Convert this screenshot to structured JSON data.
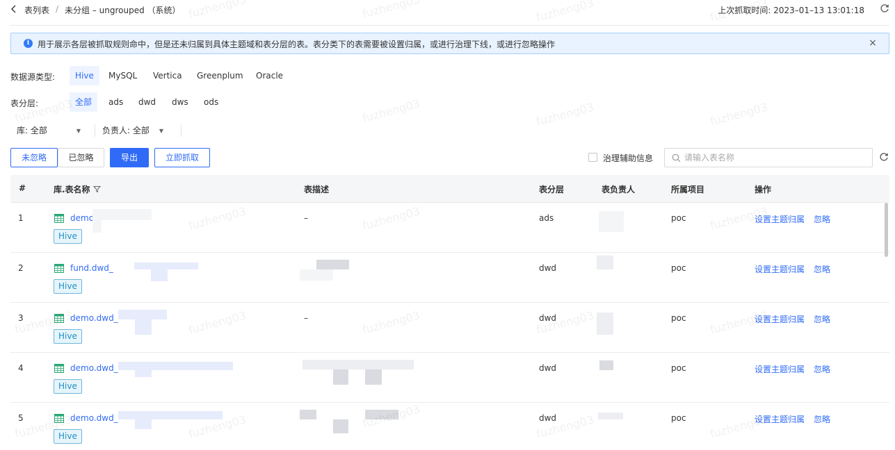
{
  "header": {
    "breadcrumb_parent": "表列表",
    "breadcrumb_sep": "/",
    "breadcrumb_current": "未分组 – ungrouped （系统）",
    "last_fetch": "上次抓取时间: 2023–01–13 13:01:18"
  },
  "alert": {
    "icon_glyph": "i",
    "text": "用于展示各层被抓取规则命中，但是还未归属到具体主题域和表分层的表。表分类下的表需要被设置归属，或进行治理下线，或进行忽略操作",
    "close_glyph": "×"
  },
  "datasource": {
    "label": "数据源类型:",
    "options": [
      "Hive",
      "MySQL",
      "Vertica",
      "Greenplum",
      "Oracle"
    ],
    "selected": "Hive"
  },
  "layer": {
    "label": "表分层:",
    "options": [
      "全部",
      "ads",
      "dwd",
      "dws",
      "ods"
    ],
    "selected": "全部"
  },
  "selects": {
    "db": "库: 全部",
    "owner": "负责人: 全部"
  },
  "actions": {
    "not_ignored": "未忽略",
    "ignored": "已忽略",
    "export": "导出",
    "fetch_now": "立即抓取",
    "governance_info": "治理辅助信息",
    "search_placeholder": "请输入表名称"
  },
  "table": {
    "columns": [
      "#",
      "库.表名称",
      "表描述",
      "表分层",
      "表负责人",
      "所属项目",
      "操作"
    ],
    "rows": [
      {
        "index": "1",
        "name": "demo",
        "tag": "Hive",
        "desc": "–",
        "layer": "ads",
        "project": "poc",
        "action_set": "设置主题归属",
        "action_ignore": "忽略"
      },
      {
        "index": "2",
        "name": "fund.dwd_",
        "tag": "Hive",
        "desc": "",
        "layer": "dwd",
        "project": "poc",
        "action_set": "设置主题归属",
        "action_ignore": "忽略"
      },
      {
        "index": "3",
        "name": "demo.dwd_",
        "tag": "Hive",
        "desc": "–",
        "layer": "dwd",
        "project": "poc",
        "action_set": "设置主题归属",
        "action_ignore": "忽略"
      },
      {
        "index": "4",
        "name": "demo.dwd_",
        "tag": "Hive",
        "desc": "",
        "layer": "dwd",
        "project": "poc",
        "action_set": "设置主题归属",
        "action_ignore": "忽略"
      },
      {
        "index": "5",
        "name": "demo.dwd_",
        "tag": "Hive",
        "desc": "",
        "layer": "dwd",
        "project": "poc",
        "action_set": "设置主题归属",
        "action_ignore": "忽略"
      }
    ]
  },
  "watermark": "fuzheng03",
  "colors": {
    "primary": "#2f6bf6",
    "alert_bg": "#e8f3ff",
    "tag_bg": "#e6f5fb",
    "table_icon": "#2aa876"
  }
}
